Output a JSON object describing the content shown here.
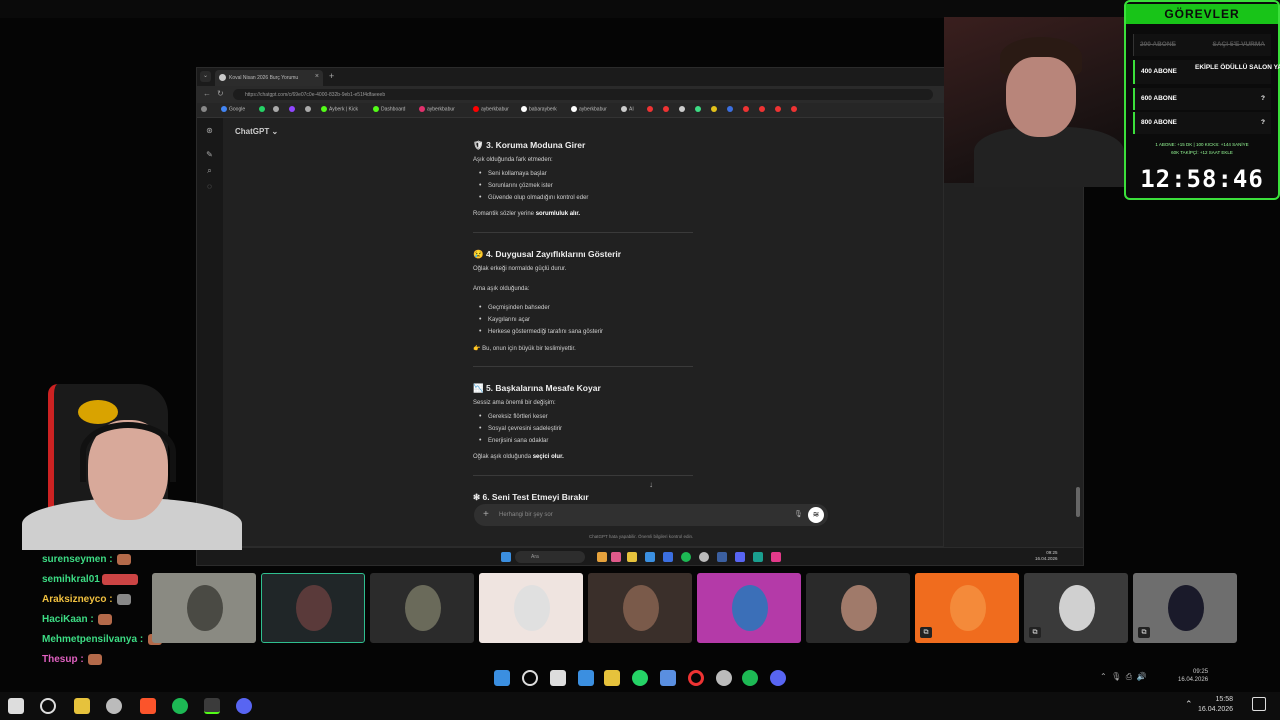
{
  "browser": {
    "tab_title": "Koval Nisan 2026 Burç Yorumu",
    "new_tab": "+",
    "url": "https://chatgpt.com/c/69e07c0e-4000-832b-9eb1-e51f4dfaeeeb",
    "bookmarks": [
      "Google",
      "Ayberk | Kick",
      "Dashboard",
      "ayberkbabur",
      "ayberkbabur",
      "babarayberk",
      "ayberkbabur",
      "AI"
    ]
  },
  "chatgpt": {
    "title": "ChatGPT ⌄",
    "sections": [
      {
        "heading": "🛡 3. Koruma Moduna Girer",
        "intro": "Aşık olduğunda fark etmeden:",
        "items": [
          "Seni kollamaya başlar",
          "Sorunlarını çözmek ister",
          "Güvende olup olmadığını kontrol eder"
        ],
        "outro_prefix": "Romantik sözler yerine ",
        "outro_bold": "sorumluluk alır."
      },
      {
        "heading": "😢 4. Duygusal Zayıflıklarını Gösterir",
        "intro": "Oğlak erkeği normalde güçlü durur.",
        "intro2": "Ama aşık olduğunda:",
        "items": [
          "Geçmişinden bahseder",
          "Kaygılarını açar",
          "Herkese göstermediği tarafını sana gösterir"
        ],
        "outro_prefix": "👉 Bu, onun için büyük bir teslimiyettir.",
        "outro_bold": ""
      },
      {
        "heading": "📉 5. Başkalarına Mesafe Koyar",
        "intro": "Sessiz ama önemli bir değişim:",
        "items": [
          "Gereksiz flörtleri keser",
          "Sosyal çevresini sadeleştirir",
          "Enerjisini sana odaklar"
        ],
        "outro_prefix": "Oğlak aşık olduğunda ",
        "outro_bold": "seçici olur."
      },
      {
        "heading": "❇ 6. Seni Test Etmeyi Bırakır"
      }
    ],
    "composer_placeholder": "Herhangi bir şey sor",
    "disclaimer": "ChatGPT hata yapabilir. Önemli bilgileri kontrol edin."
  },
  "inner_taskbar": {
    "search": "Ara",
    "time": "09:25",
    "date": "16.04.2026"
  },
  "gorevler": {
    "title": "GÖREVLER",
    "rows": [
      {
        "left": "200 ABONE",
        "right": "SAÇI 5'E VURMA",
        "done": true
      },
      {
        "left": "400 ABONE",
        "right": "EKİPLE ÖDÜLLÜ SALON YAYINI",
        "done": false
      },
      {
        "left": "600 ABONE",
        "right": "?",
        "done": false
      },
      {
        "left": "800 ABONE",
        "right": "?",
        "done": false
      }
    ],
    "info1": "1 ABONE: +15 DK | 100 KICKS: +144 SANİYE",
    "info2": "60K TAKİPÇİ: +12 SAAT EKLE",
    "timer": "12:58:46"
  },
  "chat": [
    {
      "user": "surenseymen",
      "color": "#3ddc84"
    },
    {
      "user": "semihkral01",
      "color": "#3ddc84"
    },
    {
      "user": "Araksizneyco",
      "color": "#3ddc84"
    },
    {
      "user": "HaciKaan",
      "color": "#3ddc84"
    },
    {
      "user": "Mehmetpensilvanya",
      "color": "#3ddc84"
    },
    {
      "user": "Thesup",
      "color": "#3ddc84"
    }
  ],
  "call_tiles": [
    {
      "bg": "#8a8a82",
      "av": "#4a4a44",
      "muted": false,
      "border": "#8a8a82"
    },
    {
      "bg": "#202628",
      "av": "#5a3a3a",
      "muted": false,
      "border": "#2fbf8f"
    },
    {
      "bg": "#2b2b2b",
      "av": "#6a6a5a",
      "muted": false,
      "border": "#2b2b2b"
    },
    {
      "bg": "#efe4e0",
      "av": "#e0e0e0",
      "muted": false,
      "border": "#efe4e0"
    },
    {
      "bg": "#3a2f2a",
      "av": "#7a5a4a",
      "muted": false,
      "border": "#3a2f2a"
    },
    {
      "bg": "#b43aa8",
      "av": "#3b6fb8",
      "muted": false,
      "border": "#b43aa8"
    },
    {
      "bg": "#2a2a2a",
      "av": "#a07a6a",
      "muted": false,
      "border": "#2a2a2a"
    },
    {
      "bg": "#f06c1e",
      "av": "#f48a3a",
      "muted": true,
      "border": "#f06c1e"
    },
    {
      "bg": "#3a3a3a",
      "av": "#d0d0d0",
      "muted": true,
      "border": "#3a3a3a"
    },
    {
      "bg": "#6e6e6e",
      "av": "#1a1a2a",
      "muted": true,
      "border": "#6e6e6e"
    }
  ],
  "mid_taskbar": {
    "time": "09:25",
    "date": "16.04.2026"
  },
  "taskbar": {
    "time": "15:58",
    "date": "16.04.2026"
  }
}
